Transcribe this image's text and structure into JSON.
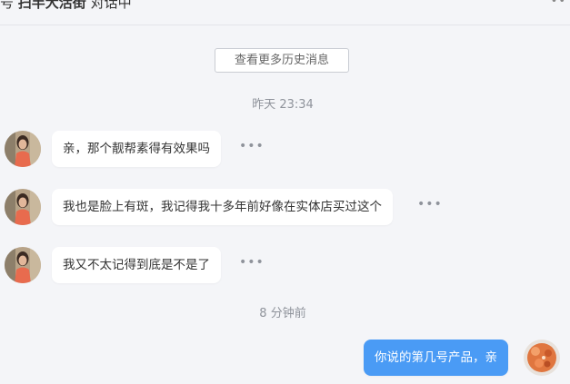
{
  "header": {
    "prefix": "号",
    "customer_name": "扫半大活街",
    "status": "对话中",
    "more_icon": "more-horizontal-icon"
  },
  "history_button": {
    "label": "查看更多历史消息"
  },
  "timestamps": [
    "昨天 23:34",
    "8 分钟前"
  ],
  "messages": [
    {
      "direction": "incoming",
      "text": "亲，那个靓帮素得有效果吗"
    },
    {
      "direction": "incoming",
      "text": "我也是脸上有斑，我记得我十多年前好像在实体店买过这个"
    },
    {
      "direction": "incoming",
      "text": "我又不太记得到底是不是了"
    },
    {
      "direction": "outgoing",
      "text": "你说的第几号产品，亲"
    }
  ],
  "message_actions": {
    "icon": "more-horizontal-icon",
    "glyph": "•••"
  },
  "colors": {
    "background": "#f4f5f8",
    "incoming_bubble": "#ffffff",
    "outgoing_bubble": "#4a9bf5",
    "meta_text": "#8f939b"
  }
}
